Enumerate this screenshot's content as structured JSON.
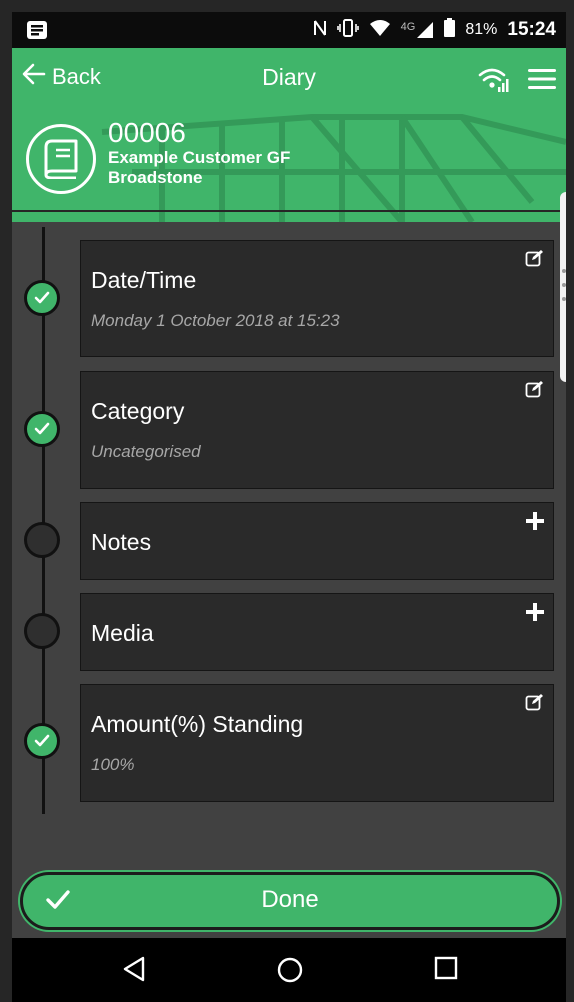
{
  "status_bar": {
    "battery": "81%",
    "network": "4G",
    "time": "15:24"
  },
  "header": {
    "back_label": "Back",
    "title": "Diary"
  },
  "job": {
    "reference": "00006",
    "customer": "Example Customer GF",
    "location": "Broadstone"
  },
  "fields": [
    {
      "label": "Date/Time",
      "value": "Monday 1 October 2018 at 15:23",
      "status": "complete",
      "action_icon": "edit-icon"
    },
    {
      "label": "Category",
      "value": "Uncategorised",
      "status": "complete",
      "action_icon": "edit-icon"
    },
    {
      "label": "Notes",
      "value": "",
      "status": "empty",
      "action_icon": "plus-icon"
    },
    {
      "label": "Media",
      "value": "",
      "status": "empty",
      "action_icon": "plus-icon"
    },
    {
      "label": "Amount(%) Standing",
      "value": "100%",
      "status": "complete",
      "action_icon": "edit-icon"
    }
  ],
  "footer": {
    "done_label": "Done"
  },
  "colors": {
    "accent": "#40b56a",
    "card": "#2a2a2a",
    "background": "#414141"
  }
}
